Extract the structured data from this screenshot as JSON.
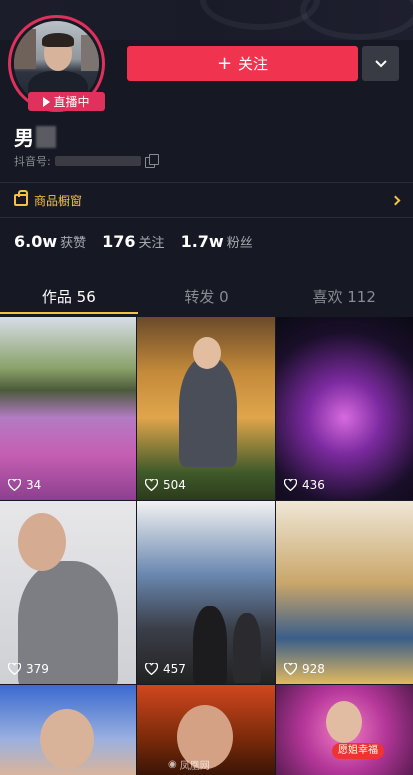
{
  "profile": {
    "live_label": "直播中",
    "follow_label": "关注",
    "name_visible": "男",
    "id_label": "抖音号:"
  },
  "shop": {
    "label": "商品橱窗"
  },
  "stats": [
    {
      "num": "6.0w",
      "label": "获赞"
    },
    {
      "num": "176",
      "label": "关注"
    },
    {
      "num": "1.7w",
      "label": "粉丝"
    }
  ],
  "tabs": [
    {
      "label": "作品 56"
    },
    {
      "label": "转发 0"
    },
    {
      "label": "喜欢 112"
    }
  ],
  "videos": [
    {
      "likes": "34"
    },
    {
      "likes": "504"
    },
    {
      "likes": "436"
    },
    {
      "likes": "379"
    },
    {
      "likes": "457"
    },
    {
      "likes": "928"
    }
  ],
  "overlays": {
    "xinfu_text": "愿姐幸福",
    "watermark_text": "凤凰网"
  },
  "colors": {
    "background": "#161823",
    "accent_follow": "#f0334f",
    "live_badge": "#e0305c",
    "shop_yellow": "#f5c144"
  }
}
